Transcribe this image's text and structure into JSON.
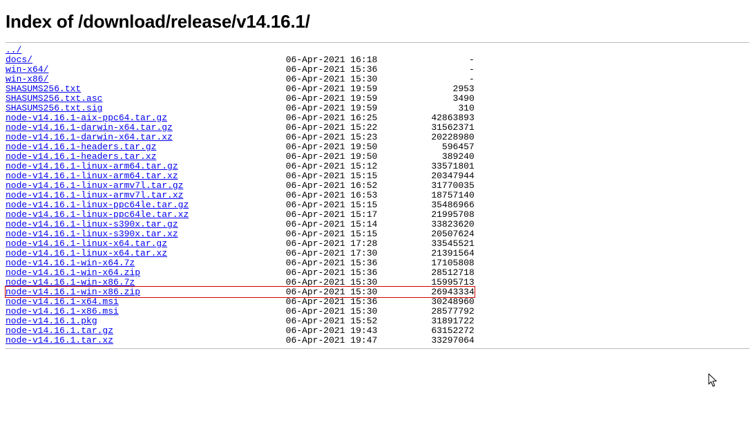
{
  "page_title": "Index of /download/release/v14.16.1/",
  "link_color": "#0000EE",
  "highlight_index": 24,
  "columns": {
    "name_width": 52,
    "date_width": 19,
    "size_width": 16
  },
  "parent": {
    "name": "../"
  },
  "entries": [
    {
      "name": "docs/",
      "date": "06-Apr-2021 16:18",
      "size": "-"
    },
    {
      "name": "win-x64/",
      "date": "06-Apr-2021 15:36",
      "size": "-"
    },
    {
      "name": "win-x86/",
      "date": "06-Apr-2021 15:30",
      "size": "-"
    },
    {
      "name": "SHASUMS256.txt",
      "date": "06-Apr-2021 19:59",
      "size": "2953"
    },
    {
      "name": "SHASUMS256.txt.asc",
      "date": "06-Apr-2021 19:59",
      "size": "3490"
    },
    {
      "name": "SHASUMS256.txt.sig",
      "date": "06-Apr-2021 19:59",
      "size": "310"
    },
    {
      "name": "node-v14.16.1-aix-ppc64.tar.gz",
      "date": "06-Apr-2021 16:25",
      "size": "42863893"
    },
    {
      "name": "node-v14.16.1-darwin-x64.tar.gz",
      "date": "06-Apr-2021 15:22",
      "size": "31562371"
    },
    {
      "name": "node-v14.16.1-darwin-x64.tar.xz",
      "date": "06-Apr-2021 15:23",
      "size": "20228980"
    },
    {
      "name": "node-v14.16.1-headers.tar.gz",
      "date": "06-Apr-2021 19:50",
      "size": "596457"
    },
    {
      "name": "node-v14.16.1-headers.tar.xz",
      "date": "06-Apr-2021 19:50",
      "size": "389240"
    },
    {
      "name": "node-v14.16.1-linux-arm64.tar.gz",
      "date": "06-Apr-2021 15:12",
      "size": "33571801"
    },
    {
      "name": "node-v14.16.1-linux-arm64.tar.xz",
      "date": "06-Apr-2021 15:15",
      "size": "20347944"
    },
    {
      "name": "node-v14.16.1-linux-armv7l.tar.gz",
      "date": "06-Apr-2021 16:52",
      "size": "31770035"
    },
    {
      "name": "node-v14.16.1-linux-armv7l.tar.xz",
      "date": "06-Apr-2021 16:53",
      "size": "18757140"
    },
    {
      "name": "node-v14.16.1-linux-ppc64le.tar.gz",
      "date": "06-Apr-2021 15:15",
      "size": "35486966"
    },
    {
      "name": "node-v14.16.1-linux-ppc64le.tar.xz",
      "date": "06-Apr-2021 15:17",
      "size": "21995708"
    },
    {
      "name": "node-v14.16.1-linux-s390x.tar.gz",
      "date": "06-Apr-2021 15:14",
      "size": "33823620"
    },
    {
      "name": "node-v14.16.1-linux-s390x.tar.xz",
      "date": "06-Apr-2021 15:15",
      "size": "20507624"
    },
    {
      "name": "node-v14.16.1-linux-x64.tar.gz",
      "date": "06-Apr-2021 17:28",
      "size": "33545521"
    },
    {
      "name": "node-v14.16.1-linux-x64.tar.xz",
      "date": "06-Apr-2021 17:30",
      "size": "21391564"
    },
    {
      "name": "node-v14.16.1-win-x64.7z",
      "date": "06-Apr-2021 15:36",
      "size": "17105808"
    },
    {
      "name": "node-v14.16.1-win-x64.zip",
      "date": "06-Apr-2021 15:36",
      "size": "28512718"
    },
    {
      "name": "node-v14.16.1-win-x86.7z",
      "date": "06-Apr-2021 15:30",
      "size": "15995713"
    },
    {
      "name": "node-v14.16.1-win-x86.zip",
      "date": "06-Apr-2021 15:30",
      "size": "26943334"
    },
    {
      "name": "node-v14.16.1-x64.msi",
      "date": "06-Apr-2021 15:36",
      "size": "30248960"
    },
    {
      "name": "node-v14.16.1-x86.msi",
      "date": "06-Apr-2021 15:30",
      "size": "28577792"
    },
    {
      "name": "node-v14.16.1.pkg",
      "date": "06-Apr-2021 15:52",
      "size": "31891722"
    },
    {
      "name": "node-v14.16.1.tar.gz",
      "date": "06-Apr-2021 19:43",
      "size": "63152272"
    },
    {
      "name": "node-v14.16.1.tar.xz",
      "date": "06-Apr-2021 19:47",
      "size": "33297064"
    }
  ]
}
